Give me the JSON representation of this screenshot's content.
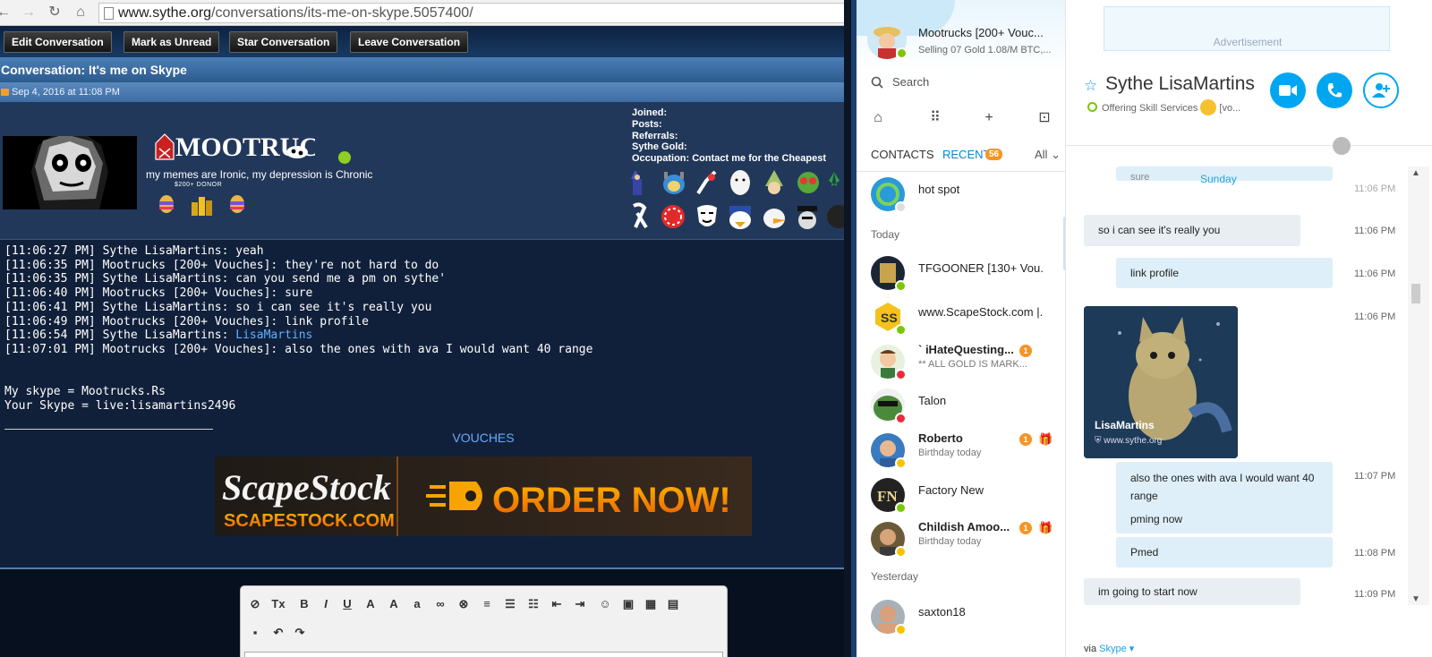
{
  "browser": {
    "url_domain": "www.sythe.org",
    "url_path": "/conversations/its-me-on-skype.5057400/",
    "toolbar": {
      "edit": "Edit Conversation",
      "unread": "Mark as Unread",
      "star": "Star Conversation",
      "leave": "Leave Conversation"
    },
    "conv_title": "Conversation: It's me on Skype",
    "conv_date": "Sep 4, 2016 at 11:08 PM",
    "user": {
      "logo_text": "MOOTRUCKS",
      "tagline": "my memes are Ironic, my depression is Chronic",
      "donor": "$200+ DONOR"
    },
    "stats": {
      "joined": "Joined:",
      "posts": "Posts:",
      "referrals": "Referrals:",
      "gold": "Sythe Gold:",
      "occupation_label": "Occupation:",
      "occupation_value": "Contact me for the Cheapest"
    },
    "chatlog": [
      "[11:06:27 PM] Sythe LisaMartins: yeah",
      "[11:06:35 PM] Mootrucks [200+ Vouches]: they're not hard to do",
      "[11:06:35 PM] Sythe LisaMartins: can you send me a pm on sythe'",
      "[11:06:40 PM] Mootrucks [200+ Vouches]: sure",
      "[11:06:41 PM] Sythe LisaMartins: so i can see it's really you",
      "[11:06:49 PM] Mootrucks [200+ Vouches]: link profile",
      "[11:06:54 PM] Sythe LisaMartins: ",
      "[11:07:01 PM] Mootrucks [200+ Vouches]: also the ones with ava I would want 40 range"
    ],
    "chatlog_link": "LisaMartins",
    "skype_line1": "My skype = Mootrucks.Rs",
    "skype_line2": "Your Skype = live:lisamartins2496",
    "vouches": "VOUCHES",
    "banner": {
      "brand": "ScapeStock",
      "domain": "SCAPESTOCK.COM",
      "cta": "ORDER NOW!"
    }
  },
  "skype_left": {
    "me_name": "Mootrucks [200+ Vouc...",
    "me_mood": "Selling 07 Gold 1.08/M BTC,...",
    "search_placeholder": "Search",
    "tabs": {
      "contacts": "CONTACTS",
      "recent": "RECENT",
      "recent_count": "56",
      "filter": "All"
    },
    "sections": {
      "today": "Today",
      "yesterday": "Yesterday"
    },
    "contacts": [
      {
        "name": "hot spot",
        "sub": "",
        "unread": "",
        "gift": false
      },
      {
        "name": "TFGOONER [130+ Vou...",
        "sub": "",
        "unread": "",
        "gift": false
      },
      {
        "name": "www.ScapeStock.com |...",
        "sub": "",
        "unread": "",
        "gift": false
      },
      {
        "name": "` iHateQuesting...",
        "sub": "** ALL GOLD IS MARK...",
        "unread": "1",
        "gift": false
      },
      {
        "name": "Talon",
        "sub": "",
        "unread": "",
        "gift": false
      },
      {
        "name": "Roberto",
        "sub": "Birthday today",
        "unread": "1",
        "gift": true
      },
      {
        "name": "Factory New",
        "sub": "",
        "unread": "",
        "gift": false
      },
      {
        "name": "Childish Amoo...",
        "sub": "Birthday today",
        "unread": "1",
        "gift": true
      },
      {
        "name": "saxton18",
        "sub": "",
        "unread": "",
        "gift": false
      }
    ],
    "colors": {
      "accent": "#00a6f0",
      "badge": "#f59524",
      "online": "#7cc700",
      "away": "#f5c400",
      "busy": "#e62e3d"
    }
  },
  "skype_right": {
    "ad_label": "Advertisement",
    "contact_name": "Sythe LisaMartins",
    "contact_mood": "Offering Skill Services",
    "contact_mood_tail": "[vo...",
    "day_label": "Sunday",
    "partial_msg": "sure",
    "partial_time": "11:06 PM",
    "messages": [
      {
        "text": "so i can see it's really you",
        "time": "11:06 PM"
      },
      {
        "text": "link profile",
        "time": "11:06 PM"
      },
      {
        "text": "also the ones with ava I would want 40 range",
        "time": "11:07 PM"
      },
      {
        "text": "pming now",
        "time": ""
      },
      {
        "text": "Pmed",
        "time": "11:08 PM"
      },
      {
        "text": "im going to start now",
        "time": "11:09 PM"
      }
    ],
    "image_msg": {
      "caption": "LisaMartins",
      "url": "www.sythe.org",
      "time": "11:06 PM"
    },
    "via_prefix": "via",
    "via_link": "Skype"
  }
}
